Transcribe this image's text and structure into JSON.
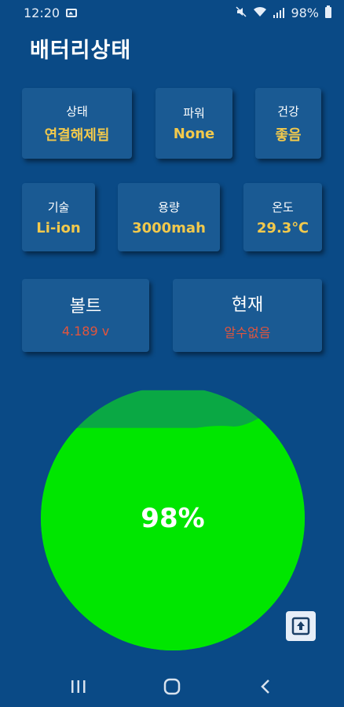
{
  "status_bar": {
    "time": "12:20",
    "battery_percent": "98%",
    "icons": [
      "image-icon",
      "mute-icon",
      "wifi-icon",
      "signal-icon",
      "battery-icon"
    ]
  },
  "app": {
    "title": "배터리상태"
  },
  "cards": {
    "status": {
      "label": "상태",
      "value": "연결해제됨"
    },
    "power": {
      "label": "파워",
      "value": "None"
    },
    "health": {
      "label": "건강",
      "value": "좋음"
    },
    "technology": {
      "label": "기술",
      "value": "Li-ion"
    },
    "capacity": {
      "label": "용량",
      "value": "3000mah"
    },
    "temperature": {
      "label": "온도",
      "value": "29.3℃"
    },
    "voltage": {
      "label": "볼트",
      "value": "4.189 v"
    },
    "current": {
      "label": "현재",
      "value": "알수없음"
    }
  },
  "gauge": {
    "level_text": "98%",
    "level": 0.98,
    "fill_color": "#00e600",
    "wave_color": "#0aa844"
  },
  "colors": {
    "background": "#0a4a86",
    "card": "#1a5a93",
    "value_yellow": "#f2c94c",
    "value_red": "#e2553d"
  },
  "nav": {
    "icons": [
      "recent-apps-icon",
      "home-icon",
      "back-icon"
    ]
  }
}
